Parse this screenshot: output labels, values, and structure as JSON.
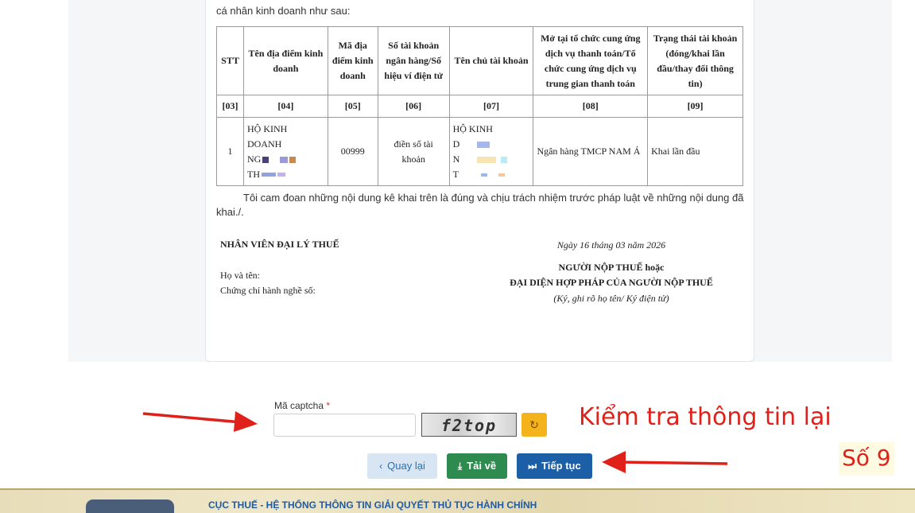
{
  "doc": {
    "intro": "cá nhân kinh doanh như sau:",
    "table": {
      "headers": [
        "STT",
        "Tên địa điểm kinh doanh",
        "Mã địa điểm kinh doanh",
        "Số tài khoản ngân hàng/Số hiệu ví điện tử",
        "Tên chủ tài khoản",
        "Mở tại tổ chức cung ứng dịch vụ thanh toán/Tổ chức cung ứng dịch vụ trung gian thanh toán",
        "Trạng thái tài khoản (đóng/khai lần đầu/thay đổi thông tin)"
      ],
      "codes": [
        "[03]",
        "[04]",
        "[05]",
        "[06]",
        "[07]",
        "[08]",
        "[09]"
      ],
      "row": {
        "stt": "1",
        "name_l1": "HỘ KINH",
        "name_l2": "DOANH",
        "name_l3": "NG",
        "name_l4": "TH",
        "code": "00999",
        "account": "điền số tài khoản",
        "owner_l1": "HỘ KINH",
        "owner_l2": "D",
        "owner_l3": "N",
        "owner_l4": "T",
        "bank": "Ngân hàng TMCP NAM Á",
        "status": "Khai lần đầu"
      }
    },
    "commitment": "Tôi cam đoan những nội dung kê khai trên là đúng và chịu trách nhiệm trước pháp luật về những nội dung đã khai./.",
    "agent_title": "NHÂN VIÊN ĐẠI LÝ THUẾ",
    "agent_name": "Họ và tên:",
    "agent_cert": "Chứng chỉ hành nghề số:",
    "date": "Ngày 16 tháng 03 năm 2026",
    "taxpayer_l1": "NGƯỜI NỘP THUẾ hoặc",
    "taxpayer_l2": "ĐẠI DIỆN HỢP PHÁP CỦA NGƯỜI NỘP THUẾ",
    "sign_note": "(Ký, ghi rõ họ tên/ Ký điện tử)"
  },
  "captcha": {
    "label": "Mã captcha",
    "required": "*",
    "value": "",
    "image_text": "f2top"
  },
  "annotations": {
    "check_info": "Kiểm tra thông tin lại",
    "step": "Số 9",
    "color": "#e0211a"
  },
  "buttons": {
    "back": "Quay lại",
    "download": "Tải về",
    "next": "Tiếp tục"
  },
  "footer": {
    "title": "CỤC THUẾ - HỆ THỐNG THÔNG TIN GIẢI QUYẾT THỦ TỤC HÀNH CHÍNH"
  }
}
